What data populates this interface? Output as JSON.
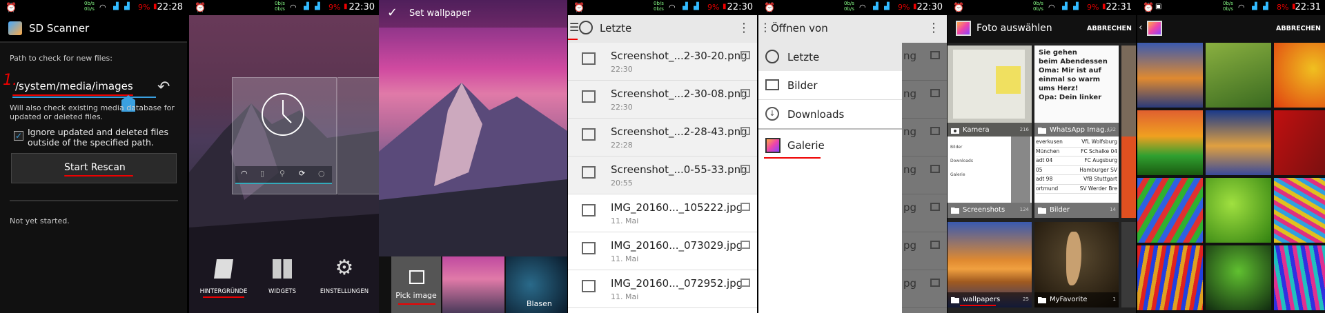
{
  "status_times": [
    "22:28",
    "22:30",
    "22:30",
    "22:30",
    "22:31"
  ],
  "status_battery": [
    "9%",
    "9%",
    "9%",
    "9%",
    "9%",
    "8%"
  ],
  "status_speed_up": "0b/s",
  "status_speed_down": "0b/s",
  "p1": {
    "title": "SD Scanner",
    "path_label": "Path to check for new files:",
    "path_value": "/system/media/images",
    "note": "Will also check existing media database for updated or deleted files.",
    "checkbox_label": "Ignore updated and deleted files outside of the specified path.",
    "button": "Start Rescan",
    "status": "Not yet started.",
    "step1": "1.",
    "step2": "2."
  },
  "p2": {
    "home_items": [
      "HINTERGRÜNDE",
      "WIDGETS",
      "EINSTELLUNGEN"
    ]
  },
  "p3": {
    "title": "Set wallpaper",
    "pick": "Pick image",
    "blasen": "Blasen"
  },
  "p4": {
    "title": "Letzte",
    "files": [
      {
        "name": "Screenshot_...2-30-20.png",
        "date": "22:30"
      },
      {
        "name": "Screenshot_...2-30-08.png",
        "date": "22:30"
      },
      {
        "name": "Screenshot_...2-28-43.png",
        "date": "22:28"
      },
      {
        "name": "Screenshot_...0-55-33.png",
        "date": "20:55"
      },
      {
        "name": "IMG_20160..._105222.jpg",
        "date": "11. Mai"
      },
      {
        "name": "IMG_20160..._073029.jpg",
        "date": "11. Mai"
      },
      {
        "name": "IMG_20160..._072952.jpg",
        "date": "11. Mai"
      }
    ]
  },
  "p5": {
    "title": "Öffnen von",
    "items": [
      "Letzte",
      "Bilder",
      "Downloads",
      "Galerie"
    ],
    "bg_frag": [
      "ng",
      "ng",
      "ng",
      "ng",
      "pg",
      "pg",
      "pg"
    ]
  },
  "p6": {
    "title": "Foto auswählen",
    "cancel": "ABBRECHEN",
    "albums": [
      {
        "name": "Kamera",
        "count": "216"
      },
      {
        "name": "WhatsApp Imag...",
        "count": "432"
      },
      {
        "name": "Screenshots",
        "count": "124"
      },
      {
        "name": "Bilder",
        "count": "14"
      },
      {
        "name": "wallpapers",
        "count": "25"
      },
      {
        "name": "MyFavorite",
        "count": "1"
      }
    ],
    "note_lines": [
      "Sie gehen",
      "beim Abendessen",
      "Oma: Mir ist auf",
      "einmal so warm",
      "ums Herz!",
      "Opa: Dein linker"
    ],
    "menu_lines": [
      "Bilder",
      "Downloads",
      "Galerie"
    ],
    "table_lines": [
      [
        "everkusen",
        "VfL Wolfsburg"
      ],
      [
        "München",
        "FC Schalke 04"
      ],
      [
        "adt 04",
        "FC Augsburg"
      ],
      [
        "05",
        "Hamburger SV"
      ],
      [
        "adt 98",
        "VfB Stuttgart"
      ],
      [
        "ortmund",
        "SV Werder Bre"
      ]
    ]
  },
  "p7": {
    "cancel": "ABBRECHEN"
  }
}
